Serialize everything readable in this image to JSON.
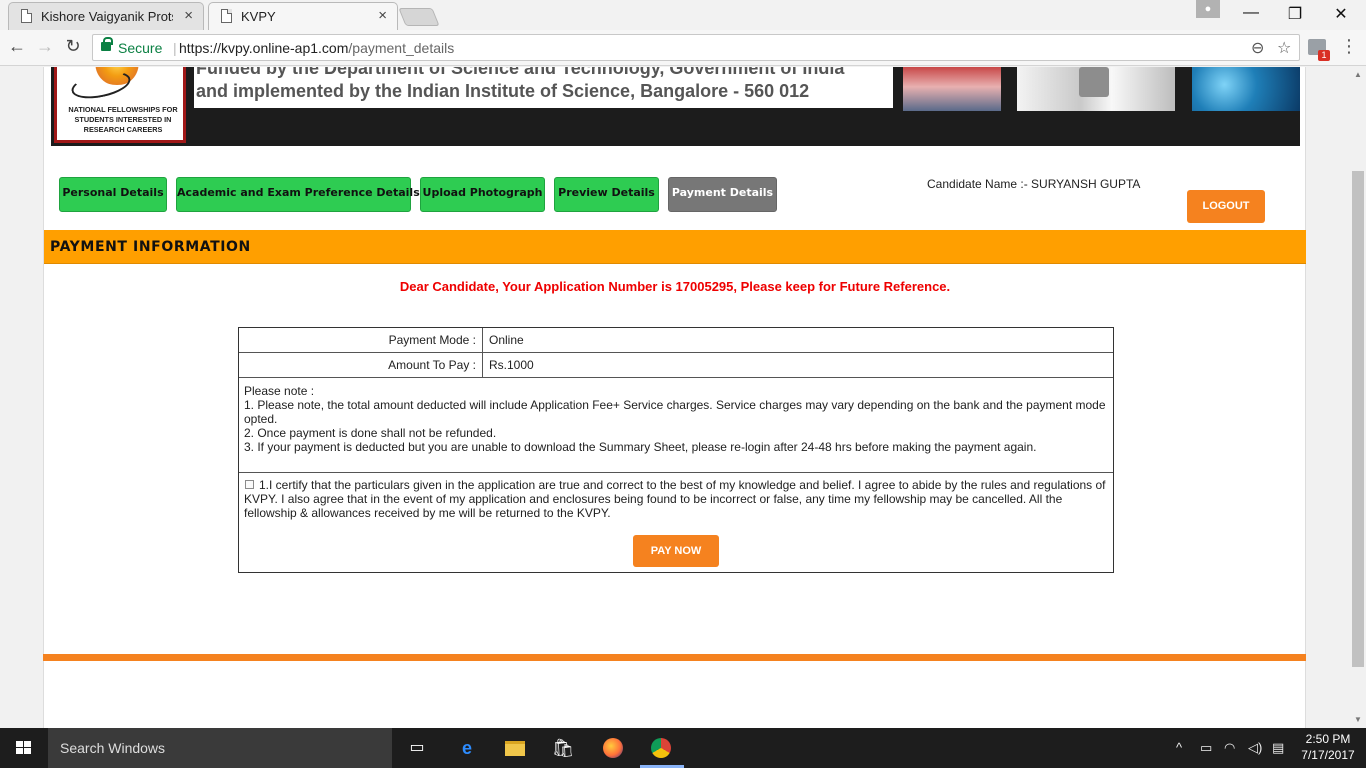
{
  "browser": {
    "tabs": [
      {
        "title": "Kishore Vaigyanik Protsa",
        "close": "×"
      },
      {
        "title": "KVPY",
        "close": "×"
      }
    ],
    "secure_label": "Secure",
    "separator": "|",
    "url_host": "https://kvpy.online-ap1.com",
    "url_path": "/payment_details",
    "nav": {
      "back": "←",
      "forward": "→",
      "reload": "↻"
    },
    "icons": {
      "zoom": "⊖",
      "star": "☆",
      "menu": "⋮"
    },
    "extension_badge": "1",
    "window_controls": {
      "minimize": "—",
      "maximize": "❐",
      "close": "✕"
    }
  },
  "banner": {
    "logo_text": "NATIONAL FELLOWSHIPS FOR STUDENTS INTERESTED IN RESEARCH CAREERS",
    "line1": "Funded by the Department of Science and Technology, Government of India",
    "line2": "and implemented by the Indian Institute of Science, Bangalore - 560 012"
  },
  "steps": [
    {
      "label": "Personal Details",
      "active": false
    },
    {
      "label": "Academic and Exam Preference Details",
      "active": false
    },
    {
      "label": "Upload Photograph",
      "active": false
    },
    {
      "label": "Preview Details",
      "active": false
    },
    {
      "label": "Payment Details",
      "active": true
    }
  ],
  "candidate_name": "Candidate Name :- SURYANSH GUPTA",
  "logout_label": "LOGOUT",
  "section_title": "PAYMENT INFORMATION",
  "application_message": "Dear Candidate, Your Application Number is 17005295, Please keep for Future Reference.",
  "payment": {
    "mode_label": "Payment Mode :",
    "mode_value": "Online",
    "amount_label": "Amount To Pay :",
    "amount_value": "Rs.1000"
  },
  "notes": [
    "Please note :",
    "1. Please note, the total amount deducted will include Application Fee+ Service charges. Service charges may vary depending on the bank and the payment mode opted.",
    "2. Once payment is done shall not be refunded.",
    "3. If your payment is deducted but you are unable to download the Summary Sheet, please re-login after 24-48 hrs before making the payment again."
  ],
  "certification": "1.I certify that the particulars given in the application are true and correct to the best of my knowledge and belief. I agree to abide by the rules and regulations of KVPY. I also agree that in the event of my application and enclosures being found to be incorrect or false, any time my fellowship may be cancelled. All the fellowship & allowances received by me will be returned to the KVPY.",
  "pay_now_label": "PAY NOW",
  "taskbar": {
    "search_placeholder": "Search Windows",
    "time": "2:50 PM",
    "date": "7/17/2017"
  },
  "colors": {
    "accent_orange": "#f5821f",
    "section_bar": "#ff9f00",
    "step_green": "#2ecc52",
    "step_active": "#777777",
    "message_red": "#ee0000",
    "secure_green": "#0b8043"
  }
}
